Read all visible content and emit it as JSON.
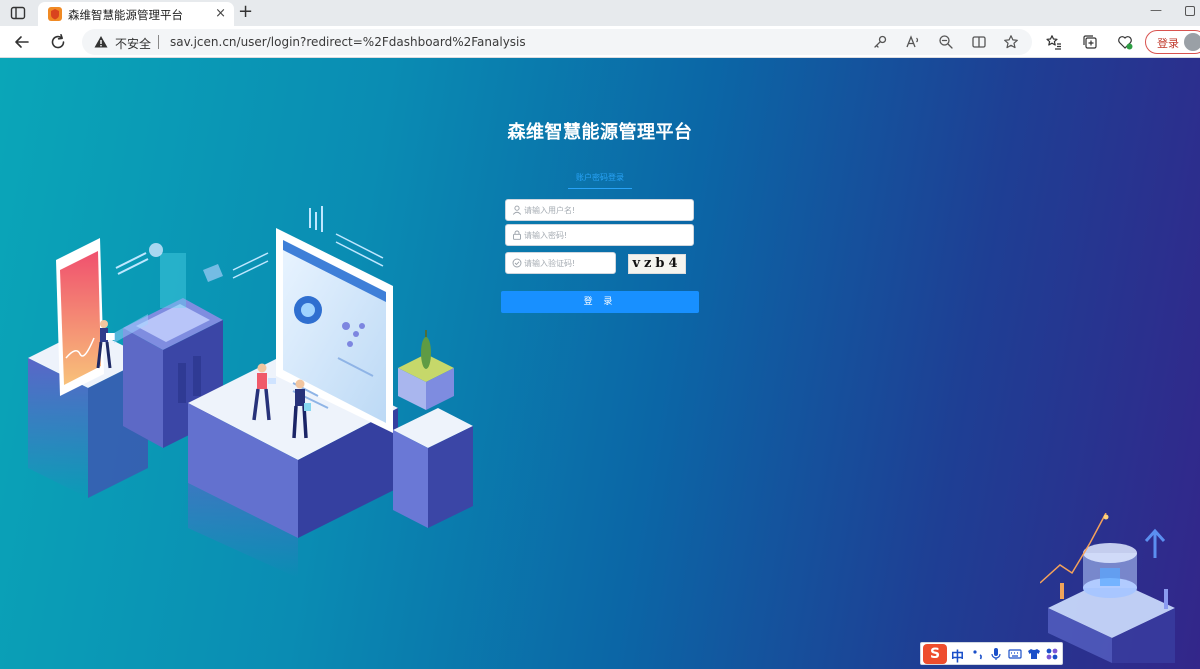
{
  "browser": {
    "tab": {
      "title": "森维智慧能源管理平台"
    },
    "new_tab_glyph": "+",
    "close_glyph": "×",
    "minimize_glyph": "—",
    "address": {
      "security_label": "不安全",
      "url": "sav.jcen.cn/user/login?redirect=%2Fdashboard%2Fanalysis"
    },
    "profile_login_label": "登录"
  },
  "login": {
    "title": "森维智慧能源管理平台",
    "tab_label": "账户密码登录",
    "username_placeholder": "请输入用户名!",
    "password_placeholder": "请输入密码!",
    "captcha_placeholder": "请输入验证码!",
    "captcha_text": "vzb4",
    "submit_label": "登 录"
  },
  "ime": {
    "logo": "S",
    "mode": "中"
  },
  "colors": {
    "primary": "#1890ff",
    "tab_accent": "#29a3f7",
    "title": "#ffffff",
    "bg_left": "#0aa6b8",
    "bg_right": "#33268a"
  }
}
